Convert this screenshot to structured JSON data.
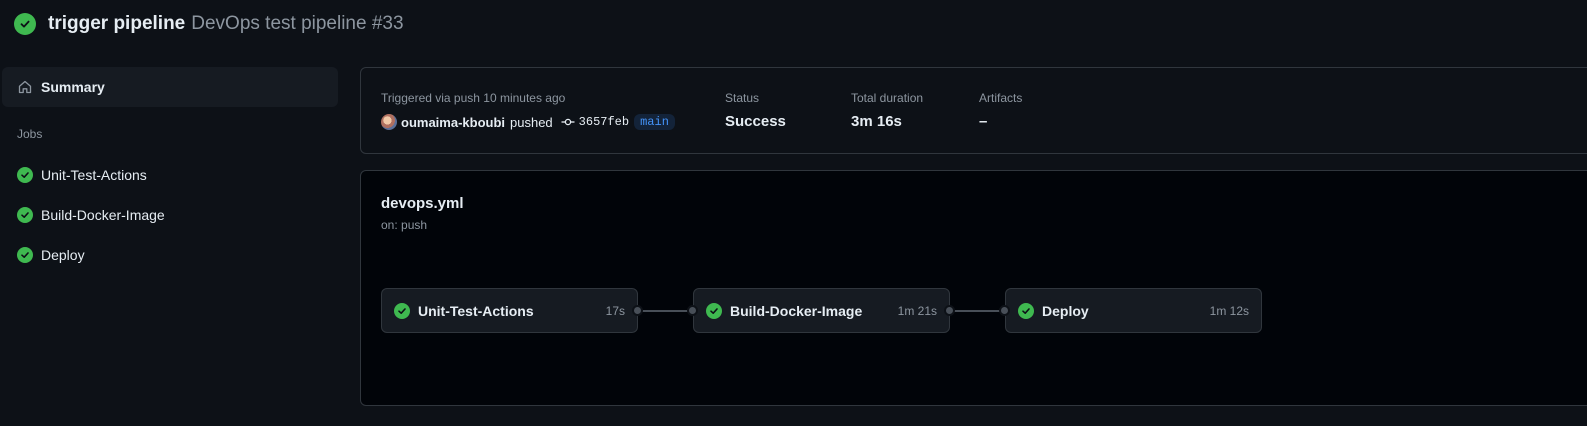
{
  "header": {
    "title": "trigger pipeline",
    "subtitle": "DevOps test pipeline #33"
  },
  "sidebar": {
    "summary_label": "Summary",
    "jobs_heading": "Jobs",
    "jobs": [
      {
        "label": "Unit-Test-Actions",
        "status": "success"
      },
      {
        "label": "Build-Docker-Image",
        "status": "success"
      },
      {
        "label": "Deploy",
        "status": "success"
      }
    ]
  },
  "summary": {
    "trigger_text": "Triggered via push 10 minutes ago",
    "user": "oumaima-kboubi",
    "action": "pushed",
    "commit_sha": "3657feb",
    "branch": "main",
    "status_label": "Status",
    "status_value": "Success",
    "duration_label": "Total duration",
    "duration_value": "3m 16s",
    "artifacts_label": "Artifacts",
    "artifacts_value": "–"
  },
  "workflow": {
    "file": "devops.yml",
    "trigger": "on: push",
    "jobs": [
      {
        "name": "Unit-Test-Actions",
        "duration": "17s"
      },
      {
        "name": "Build-Docker-Image",
        "duration": "1m 21s"
      },
      {
        "name": "Deploy",
        "duration": "1m 12s"
      }
    ]
  },
  "colors": {
    "background": "#0d1117",
    "success": "#3fb950",
    "border": "#30363d",
    "muted": "#8d96a0",
    "branch": "#4493f8"
  }
}
